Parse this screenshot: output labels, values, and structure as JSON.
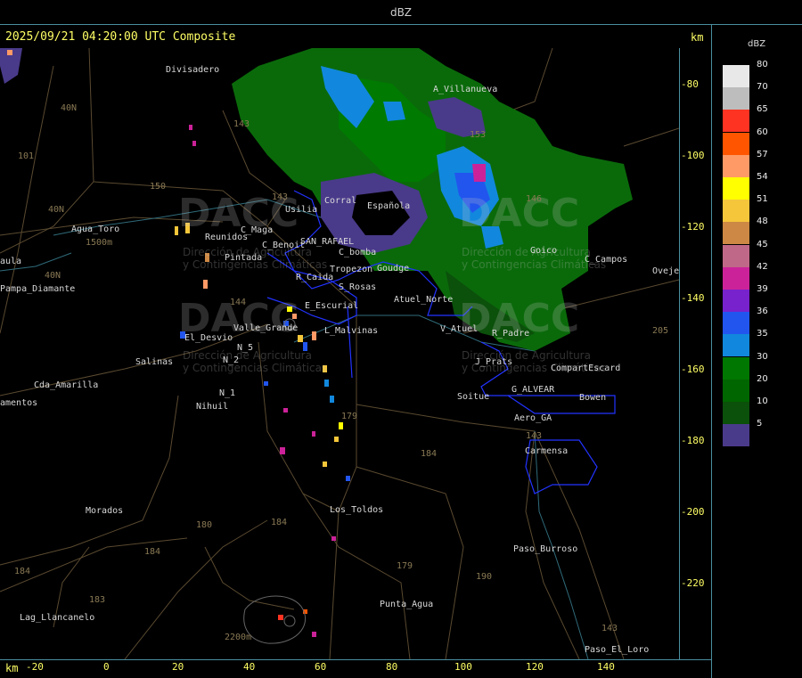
{
  "window": {
    "title": "dBZ"
  },
  "header": {
    "timestamp": "2025/09/21 04:20:00 UTC Composite",
    "unit_top": "km",
    "unit_bottom": "km"
  },
  "x_axis": {
    "ticks": [
      "-20",
      "0",
      "20",
      "40",
      "60",
      "80",
      "100",
      "120",
      "140"
    ]
  },
  "y_axis": {
    "ticks": [
      "-80",
      "-100",
      "-120",
      "-140",
      "-160",
      "-180",
      "-200",
      "-220"
    ]
  },
  "legend": {
    "unit": "dBZ",
    "items": [
      {
        "value": "80",
        "color": "#e8e8e8"
      },
      {
        "value": "70",
        "color": "#bdbdbd"
      },
      {
        "value": "65",
        "color": "#ff3322"
      },
      {
        "value": "60",
        "color": "#ff5500"
      },
      {
        "value": "57",
        "color": "#ff9966"
      },
      {
        "value": "54",
        "color": "#ffff00"
      },
      {
        "value": "51",
        "color": "#f5c63a"
      },
      {
        "value": "48",
        "color": "#cc8844"
      },
      {
        "value": "45",
        "color": "#c06888"
      },
      {
        "value": "42",
        "color": "#cc2299"
      },
      {
        "value": "39",
        "color": "#7722cc"
      },
      {
        "value": "36",
        "color": "#2255ee"
      },
      {
        "value": "35",
        "color": "#1188dd"
      },
      {
        "value": "30",
        "color": "#007700"
      },
      {
        "value": "20",
        "color": "#006600"
      },
      {
        "value": "10",
        "color": "#0b500b"
      },
      {
        "value": "5",
        "color": "#4a3a8a"
      }
    ]
  },
  "places": {
    "p1": "Divisadero",
    "p2": "A_Villanueva",
    "p3": "Usilia",
    "p4": "Corral",
    "p5": "Española",
    "p6": "Agua_Toro",
    "p7": "Reunidos",
    "p8": "C_Maga",
    "p9": "C_Benoit",
    "p10": "SAN_RAFAEL",
    "p11": "C_bomba",
    "p12": "Pintada",
    "p13": "Tropezon",
    "p14": "Goudge",
    "p15": "R_Caida",
    "p16": "S_Rosas",
    "p17": "Atuel_Norte",
    "p18": "E_Escurial",
    "p19": "Valle_Grande",
    "p20": "L_Malvinas",
    "p21": "V_Atuel",
    "p22": "R_Padre",
    "p23": "El_Desvio",
    "p24": "N_5",
    "p25": "N_2",
    "p26": "Salinas",
    "p27": "N_1",
    "p28": "Nihuil",
    "p29": "J_Prats",
    "p30": "CompartEscard",
    "p31": "G_ALVEAR",
    "p32": "Soitue",
    "p33": "Bowen",
    "p34": "Aero_GA",
    "p35": "Carmensa",
    "p36": "Los_Toldos",
    "p37": "Morados",
    "p38": "Paso_Burroso",
    "p39": "Punta_Agua",
    "p40": "Lag_Llancanelo",
    "p41": "Paso_El_Loro",
    "p42": "Cda_Amarilla",
    "p43": "Pampa_Diamante",
    "p44": "Goico",
    "p45": "C_Campos",
    "p46": "Ovejeria",
    "p47": "amentos",
    "p48": "aula",
    "p49": "1500m",
    "p50": "2200m"
  },
  "routes": {
    "r1": "143",
    "r2": "40N",
    "r3": "101",
    "r4": "150",
    "r5": "143",
    "r6": "144",
    "r7": "179",
    "r8": "184",
    "r9": "180",
    "r10": "184",
    "r11": "184",
    "r12": "179",
    "r13": "190",
    "r14": "183",
    "r15": "143",
    "r16": "205",
    "r17": "146",
    "r18": "40N",
    "r19": "184",
    "r20": "143",
    "r21": "153",
    "r22": "40N"
  },
  "watermark": {
    "brand": "DACC",
    "line1": "Dirección de Agricultura",
    "line2": "y Contingencias Climáticas"
  }
}
